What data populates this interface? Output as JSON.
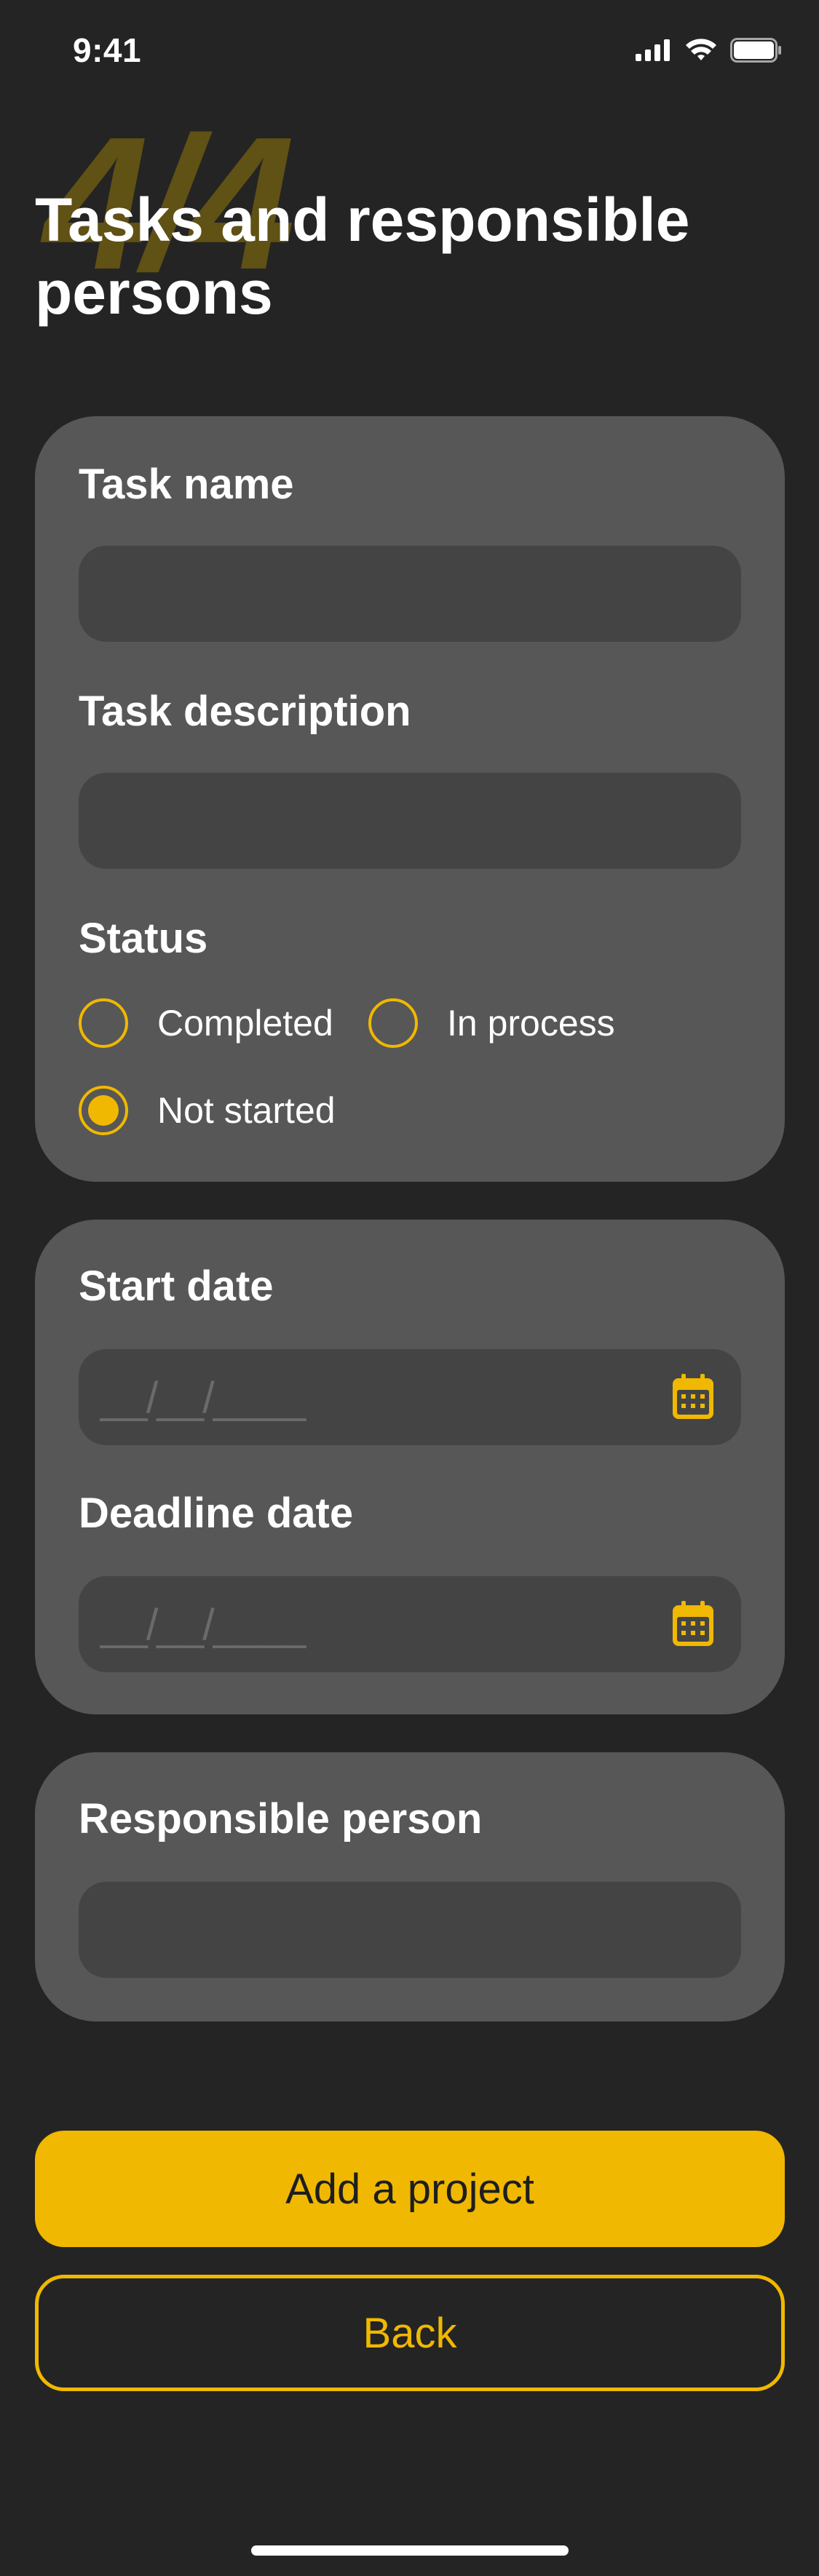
{
  "status_bar": {
    "time": "9:41",
    "icons": [
      "signal-icon",
      "wifi-icon",
      "battery-icon"
    ]
  },
  "header": {
    "step": "4/4",
    "title": "Tasks and responsible persons"
  },
  "task_card": {
    "task_name_label": "Task name",
    "task_name_value": "",
    "task_description_label": "Task description",
    "task_description_value": "",
    "status_label": "Status",
    "status_options": [
      {
        "label": "Completed",
        "checked": false
      },
      {
        "label": "In process",
        "checked": false
      },
      {
        "label": "Not started",
        "checked": true
      }
    ]
  },
  "dates_card": {
    "start_date_label": "Start date",
    "start_date_placeholder": "__/__/____",
    "deadline_date_label": "Deadline date",
    "deadline_date_placeholder": "__/__/____",
    "icon": "calendar-icon"
  },
  "person_card": {
    "responsible_person_label": "Responsible person",
    "responsible_person_value": ""
  },
  "actions": {
    "primary_label": "Add a project",
    "secondary_label": "Back"
  },
  "colors": {
    "background": "#242424",
    "card": "#575757",
    "input": "#444444",
    "accent": "#f0b800",
    "step_number": "#6b5a12"
  }
}
